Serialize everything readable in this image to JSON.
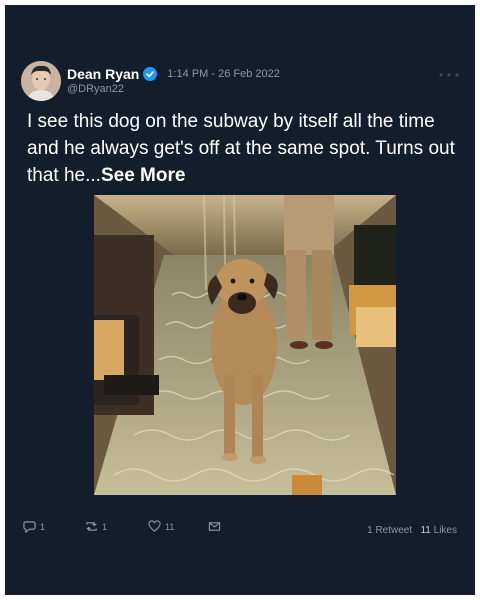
{
  "tweet": {
    "author_name": "Dean Ryan",
    "author_handle": "@DRyan22",
    "timestamp": "1:14 PM - 26 Feb 2022",
    "text": "I see this dog on the subway by itself all the time and he always get's off at the same spot. Turns out that he...",
    "see_more_label": "See More",
    "avatar_icon": "profile-photo",
    "verified_icon": "verified-badge-icon",
    "menu_icon": "more-dots-icon"
  },
  "actions": {
    "reply_count": "1",
    "retweet_count": "1",
    "like_count": "11",
    "reply_icon": "reply-icon",
    "retweet_icon": "retweet-icon",
    "like_icon": "heart-icon",
    "message_icon": "message-icon"
  },
  "stats": {
    "retweets_value": "1",
    "retweets_label": "Retweet",
    "likes_value": "11",
    "likes_label": "Likes"
  },
  "colors": {
    "background": "#141d2b",
    "muted_text": "#8899a6",
    "verified_blue": "#1d9bf0"
  }
}
